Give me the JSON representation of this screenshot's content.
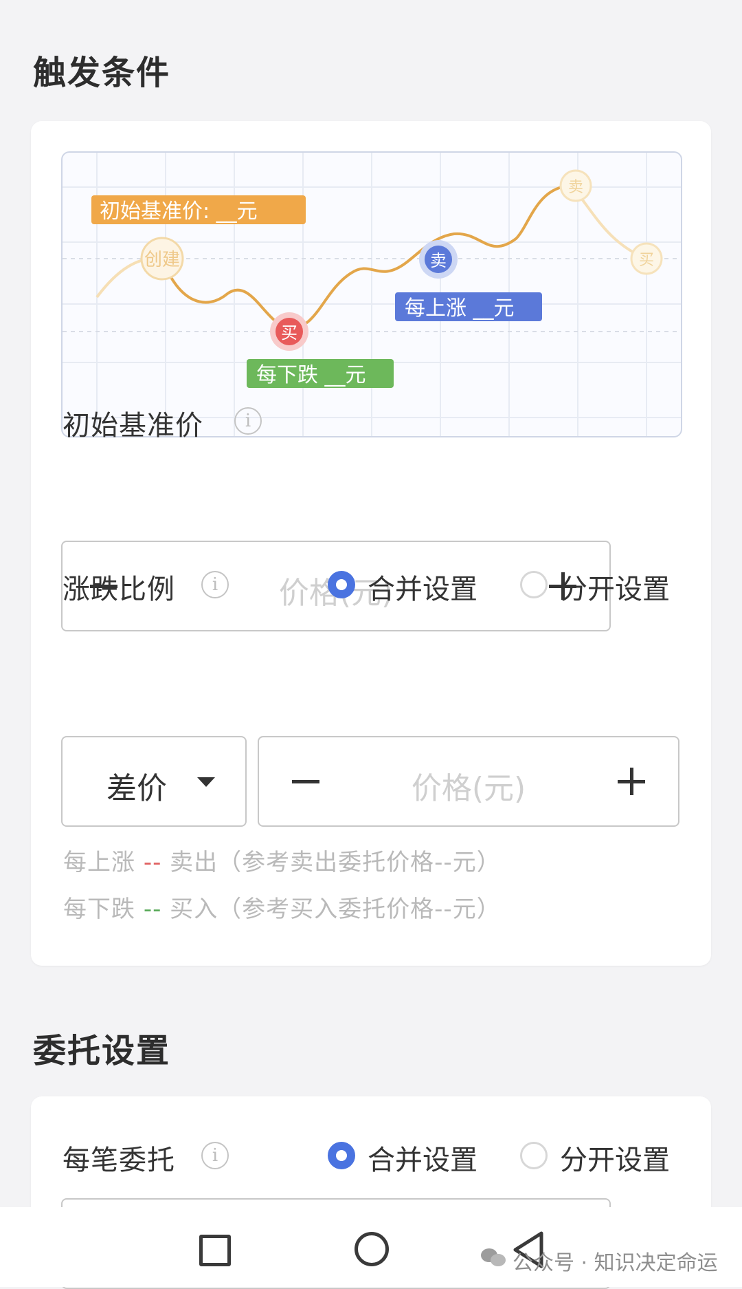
{
  "trigger": {
    "title": "触发条件",
    "chart_tags": {
      "base": "初始基准价: __元",
      "rise": "每上涨 __元",
      "fall": "每下跌 __元"
    },
    "chart_nodes": {
      "create": "创建",
      "buy": "买",
      "sell": "卖"
    },
    "base_price": {
      "label": "初始基准价",
      "placeholder": "价格(元)"
    },
    "ratio": {
      "label": "涨跌比例",
      "opt_merge": "合并设置",
      "opt_split": "分开设置",
      "type_value": "差价",
      "placeholder": "价格(元)"
    },
    "hint_rise": {
      "prefix": "每上涨 ",
      "dash": "--",
      "suffix": " 卖出（参考卖出委托价格--元）"
    },
    "hint_fall": {
      "prefix": "每下跌 ",
      "dash": "--",
      "suffix": " 买入（参考买入委托价格--元）"
    }
  },
  "order": {
    "title": "委托设置",
    "per_order": {
      "label": "每笔委托",
      "opt_merge": "合并设置",
      "opt_split": "分开设置"
    }
  },
  "watermark": "公众号 · 知识决定命运",
  "colors": {
    "accent": "#4a73e0",
    "tag_base": "#f0a849",
    "tag_rise": "#5b79d9",
    "tag_fall": "#6db85b",
    "buy": "#e85a5a",
    "line": "#e3a64a"
  }
}
